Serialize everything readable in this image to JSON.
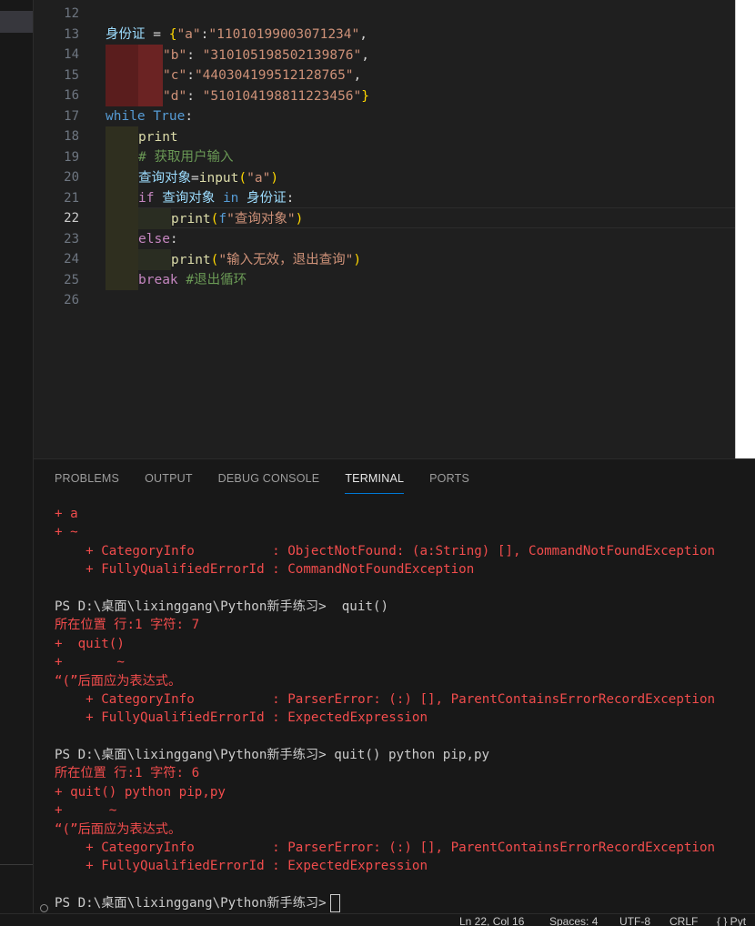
{
  "editor": {
    "line_numbers": [
      "12",
      "13",
      "14",
      "15",
      "16",
      "17",
      "18",
      "19",
      "20",
      "21",
      "22",
      "23",
      "24",
      "25",
      "26"
    ],
    "active_line": "22",
    "code": {
      "l13_var": "身份证",
      "l13_eq": " = ",
      "l13_brace": "{",
      "l13_k": "\"a\"",
      "l13_colon": ":",
      "l13_v": "\"11010199003071234\"",
      "l13_comma": ",",
      "l14_k": "\"b\"",
      "l14_colon": ": ",
      "l14_v": "\"310105198502139876\"",
      "l14_comma": ",",
      "l15_k": "\"c\"",
      "l15_colon": ":",
      "l15_v": "\"440304199512128765\"",
      "l15_comma": ",",
      "l16_k": "\"d\"",
      "l16_colon": ": ",
      "l16_v": "\"510104198811223456\"",
      "l16_brace": "}",
      "l17_kw": "while",
      "l17_true": "True",
      "l17_colon": ":",
      "l18_fn": "print",
      "l19_com": "# 获取用户输入",
      "l20_var": "查询对象",
      "l20_eq": "=",
      "l20_fn": "input",
      "l20_p1": "(",
      "l20_str": "\"a\"",
      "l20_p2": ")",
      "l21_kw": "if",
      "l21_var": "查询对象",
      "l21_in": "in",
      "l21_var2": "身份证",
      "l21_colon": ":",
      "l22_fn": "print",
      "l22_p1": "(",
      "l22_f": "f",
      "l22_str": "\"查询对象\"",
      "l22_p2": ")",
      "l23_kw": "else",
      "l23_colon": ":",
      "l24_fn": "print",
      "l24_p1": "(",
      "l24_str": "\"输入无效，退出查询\"",
      "l24_p2": ")",
      "l25_kw": "break",
      "l25_com": "#退出循环"
    }
  },
  "panel": {
    "tabs": [
      "PROBLEMS",
      "OUTPUT",
      "DEBUG CONSOLE",
      "TERMINAL",
      "PORTS"
    ],
    "active_tab": "TERMINAL"
  },
  "terminal": {
    "lines": [
      {
        "text": "+ a",
        "color": "red"
      },
      {
        "text": "+ ~",
        "color": "red"
      },
      {
        "text": "    + CategoryInfo          : ObjectNotFound: (a:String) [], CommandNotFoundException",
        "color": "red"
      },
      {
        "text": "    + FullyQualifiedErrorId : CommandNotFoundException",
        "color": "red"
      },
      {
        "text": "",
        "color": "white"
      },
      {
        "text": "PS D:\\桌面\\lixinggang\\Python新手练习>  quit()",
        "color": "white"
      },
      {
        "text": "所在位置 行:1 字符: 7",
        "color": "red"
      },
      {
        "text": "+  quit()",
        "color": "red"
      },
      {
        "text": "+       ~",
        "color": "red"
      },
      {
        "text": "“(”后面应为表达式。",
        "color": "red"
      },
      {
        "text": "    + CategoryInfo          : ParserError: (:) [], ParentContainsErrorRecordException",
        "color": "red"
      },
      {
        "text": "    + FullyQualifiedErrorId : ExpectedExpression",
        "color": "red"
      },
      {
        "text": "",
        "color": "white"
      },
      {
        "text": "PS D:\\桌面\\lixinggang\\Python新手练习> quit() python pip,py",
        "color": "white"
      },
      {
        "text": "所在位置 行:1 字符: 6",
        "color": "red"
      },
      {
        "text": "+ quit() python pip,py",
        "color": "red"
      },
      {
        "text": "+      ~",
        "color": "red"
      },
      {
        "text": "“(”后面应为表达式。",
        "color": "red"
      },
      {
        "text": "    + CategoryInfo          : ParserError: (:) [], ParentContainsErrorRecordException",
        "color": "red"
      },
      {
        "text": "    + FullyQualifiedErrorId : ExpectedExpression",
        "color": "red"
      },
      {
        "text": "",
        "color": "white"
      }
    ],
    "prompt": "PS D:\\桌面\\lixinggang\\Python新手练习>"
  },
  "statusbar": {
    "position": "Ln 22, Col 16",
    "spaces": "Spaces: 4",
    "encoding": "UTF-8",
    "eol": "CRLF",
    "language": "{ } Pyt"
  },
  "colors": {
    "error_red": "#f14c4c",
    "accent": "#0078d4",
    "editor_bg": "#1f1f1f",
    "panel_bg": "#181818"
  }
}
